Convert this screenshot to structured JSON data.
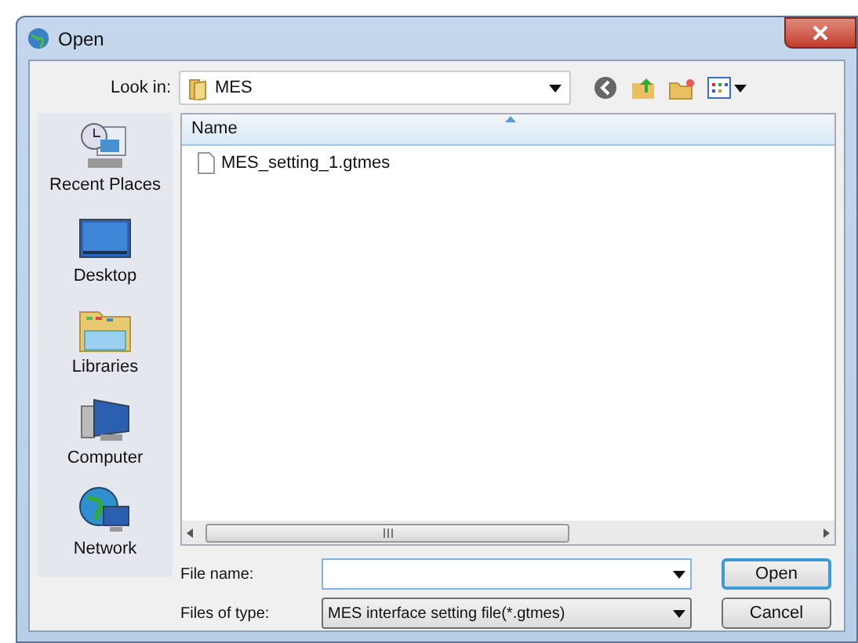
{
  "window": {
    "title": "Open"
  },
  "look_in": {
    "label": "Look in:",
    "value": "MES"
  },
  "places": [
    {
      "label": "Recent Places",
      "kind": "recent",
      "selected": false
    },
    {
      "label": "Desktop",
      "kind": "desktop",
      "selected": false
    },
    {
      "label": "Libraries",
      "kind": "libraries",
      "selected": false
    },
    {
      "label": "Computer",
      "kind": "computer",
      "selected": false
    },
    {
      "label": "Network",
      "kind": "network",
      "selected": false
    }
  ],
  "file_list": {
    "columns": [
      "Name"
    ],
    "files": [
      {
        "name": "MES_setting_1.gtmes",
        "selected": false
      }
    ]
  },
  "file_name": {
    "label": "File name:"
  },
  "file_type": {
    "label": "Files of type:",
    "value": "MES interface setting file(*.gtmes)"
  },
  "buttons": [
    {
      "label": "Open",
      "kind": "default"
    },
    {
      "label": "Cancel",
      "kind": "normal"
    }
  ]
}
